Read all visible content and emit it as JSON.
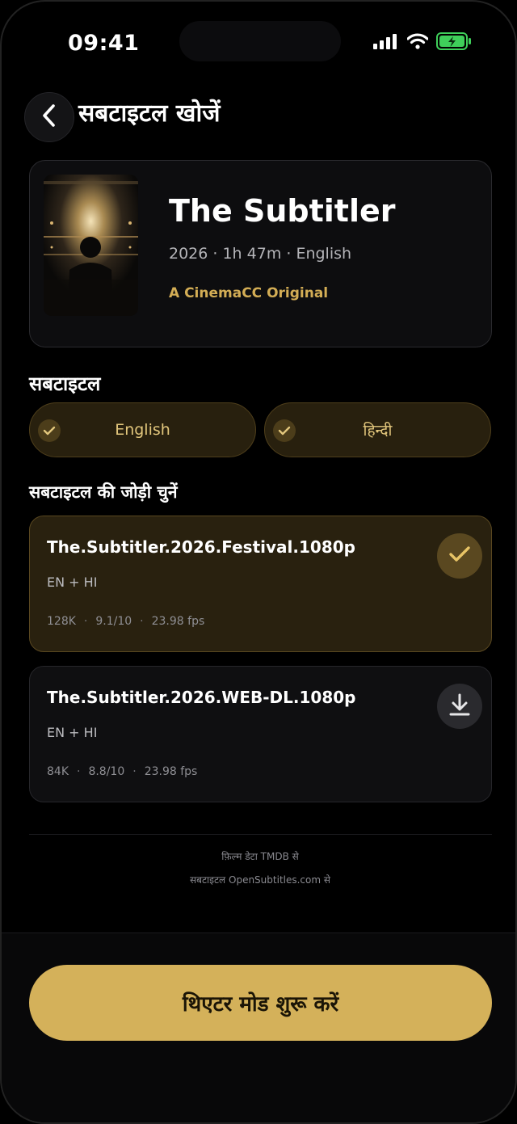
{
  "status_bar": {
    "time": "09:41"
  },
  "header": {
    "title": "सबटाइटल खोजें"
  },
  "movie": {
    "title": "The Subtitler",
    "meta": "2026 · 1h 47m · English",
    "badge": "A CinemaCC Original"
  },
  "subtitle_section": {
    "title": "सबटाइटल",
    "languages": [
      {
        "label": "English",
        "selected": true
      },
      {
        "label": "हिन्दी",
        "selected": true
      }
    ]
  },
  "pair_section": {
    "title": "सबटाइटल की जोड़ी चुनें",
    "results": [
      {
        "name": "The.Subtitler.2026.Festival.1080p",
        "langs": "EN + HI",
        "downloads": "128K",
        "rating": "9.1/10",
        "fps": "23.98 fps",
        "state": "selected",
        "action_icon": "check-icon"
      },
      {
        "name": "The.Subtitler.2026.WEB-DL.1080p",
        "langs": "EN + HI",
        "downloads": "84K",
        "rating": "8.8/10",
        "fps": "23.98 fps",
        "state": "available",
        "action_icon": "download-icon"
      }
    ]
  },
  "credits": {
    "line1": "फ़िल्म डेटा TMDB से",
    "line2": "सबटाइटल OpenSubtitles.com से"
  },
  "cta": {
    "label": "थिएटर मोड शुरू करें"
  },
  "colors": {
    "accent": "#d4b15a",
    "selected_card_bg": "#29210f",
    "battery": "#3fcf5a"
  }
}
